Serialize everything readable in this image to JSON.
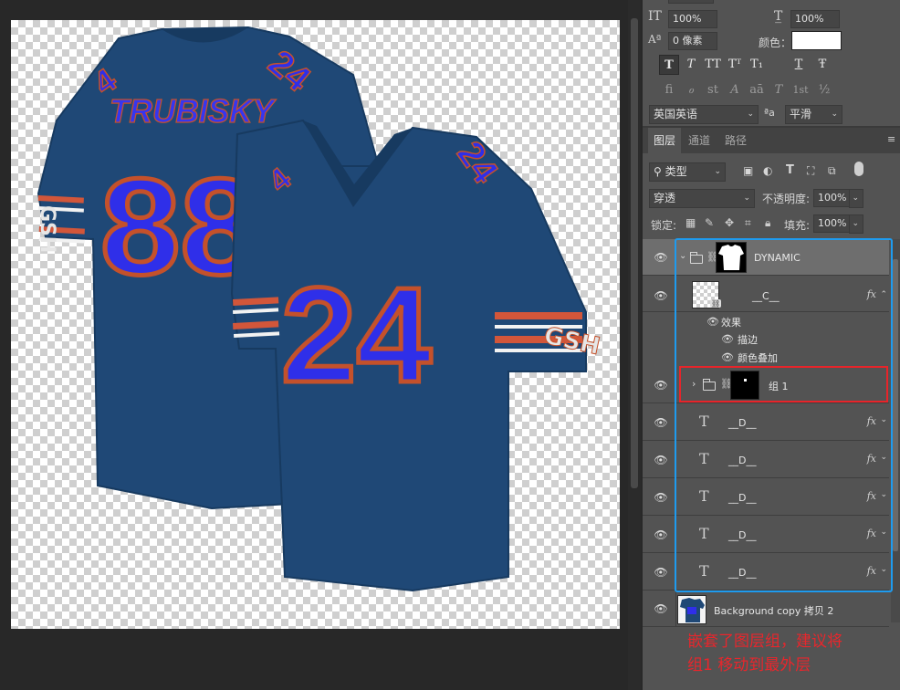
{
  "canvas": {
    "jersey_back": {
      "player_name": "TRUBISKY",
      "number": "88",
      "shoulder_number": "24",
      "sleeve_text": "GSH"
    },
    "jersey_front": {
      "number": "24",
      "shoulder_number": "24",
      "sleeve_text": "GSH"
    },
    "colors": {
      "jersey_navy": "#1f4876",
      "number_fill": "#2f2fe9",
      "number_outline": "#c4512b",
      "stripe_orange": "#d2563a"
    }
  },
  "character_panel": {
    "vertical_scale_icon": "IT",
    "vertical_scale": "100%",
    "horizontal_scale": "100%",
    "baseline_shift": "0 像素",
    "color_label": "颜色：",
    "color_value": "#ffffff",
    "style_buttons": [
      "T",
      "T",
      "TT",
      "Tᵀ",
      "T₁",
      "T",
      "Ŧ"
    ],
    "opentype_buttons": [
      "fi",
      "ℴ",
      "st",
      "A",
      "aā",
      "T",
      "1st",
      "½"
    ],
    "language": "英国英语",
    "aa_icon": "ªa",
    "antialias": "平滑"
  },
  "layers_panel": {
    "tabs": [
      "图层",
      "通道",
      "路径"
    ],
    "active_tab": "图层",
    "filter_kind": "类型",
    "blend_mode": "穿透",
    "opacity_label": "不透明度:",
    "opacity_value": "100%",
    "lock_label": "锁定:",
    "fill_label": "填充:",
    "fill_value": "100%",
    "layers": [
      {
        "name": "DYNAMIC",
        "type": "group",
        "selected": true
      },
      {
        "name": "__C__",
        "type": "pixel",
        "fx": "fx"
      },
      {
        "name": "效果",
        "type": "effects-header"
      },
      {
        "name": "描边",
        "type": "effect"
      },
      {
        "name": "颜色叠加",
        "type": "effect"
      },
      {
        "name": "组 1",
        "type": "group"
      },
      {
        "name": "__D__",
        "type": "text",
        "fx": "fx"
      },
      {
        "name": "__D__",
        "type": "text",
        "fx": "fx"
      },
      {
        "name": "__D__",
        "type": "text",
        "fx": "fx"
      },
      {
        "name": "__D__",
        "type": "text",
        "fx": "fx"
      },
      {
        "name": "__D__",
        "type": "text",
        "fx": "fx"
      },
      {
        "name": "Background copy 拷贝 2",
        "type": "pixel"
      }
    ]
  },
  "annotation": {
    "line1": "嵌套了图层组，建议将",
    "line2": "组1 移动到最外层",
    "color": "#e8262c"
  }
}
